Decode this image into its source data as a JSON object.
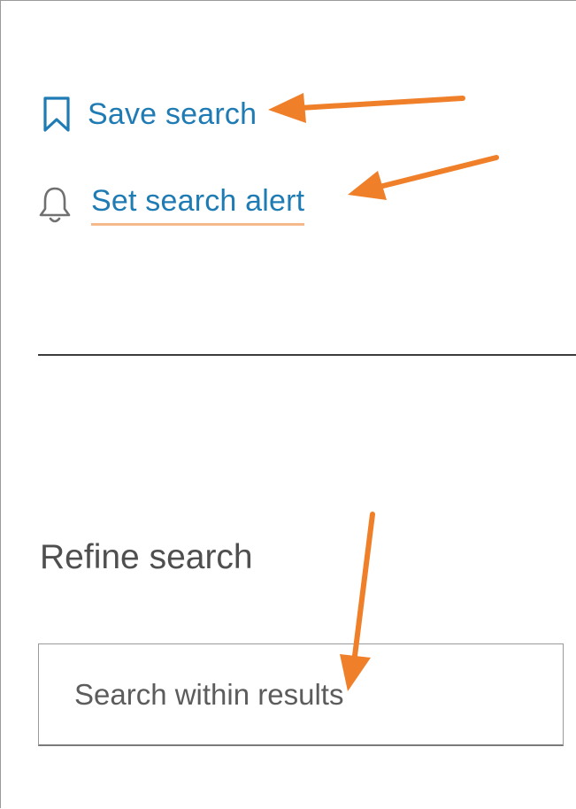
{
  "actions": {
    "save_search": {
      "label": "Save search",
      "icon": "bookmark-icon"
    },
    "set_search_alert": {
      "label": "Set search alert",
      "icon": "bell-icon"
    }
  },
  "refine": {
    "title": "Refine search",
    "search_placeholder": "Search within results"
  },
  "colors": {
    "link": "#1f7bb4",
    "link_underline": "#f4b88a",
    "annotation_arrow": "#f07f2a",
    "heading": "#4f4f4f",
    "icon_bookmark": "#1f7bb4",
    "icon_bell": "#707070"
  }
}
